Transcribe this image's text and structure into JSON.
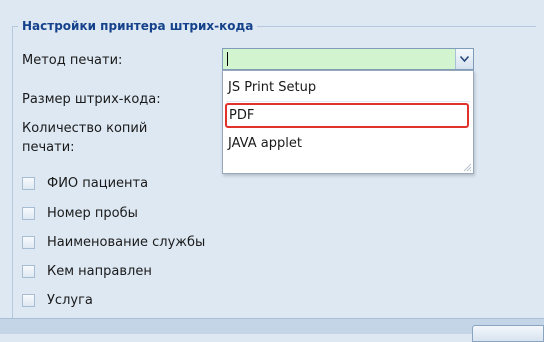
{
  "fieldset": {
    "legend": "Настройки принтера штрих-кода"
  },
  "form": {
    "print_method_label": "Метод печати:",
    "barcode_size_label": "Размер штрих-кода:",
    "copies_label_line1": "Количество копий",
    "copies_label_line2": "печати:",
    "print_method_value": ""
  },
  "dropdown": {
    "options": [
      {
        "label": "JS Print Setup"
      },
      {
        "label": "PDF"
      },
      {
        "label": "JAVA applet"
      }
    ],
    "highlighted_index": 1,
    "highlight_color": "#e0312b"
  },
  "checkboxes": [
    {
      "label": "ФИО пациента",
      "checked": false
    },
    {
      "label": "Номер пробы",
      "checked": false
    },
    {
      "label": "Наименование службы",
      "checked": false
    },
    {
      "label": "Кем направлен",
      "checked": false
    },
    {
      "label": "Услуга",
      "checked": false
    }
  ],
  "colors": {
    "panel_bg": "#dde8f3",
    "legend_text": "#15428b",
    "combo_bg": "#d2f5cf"
  }
}
